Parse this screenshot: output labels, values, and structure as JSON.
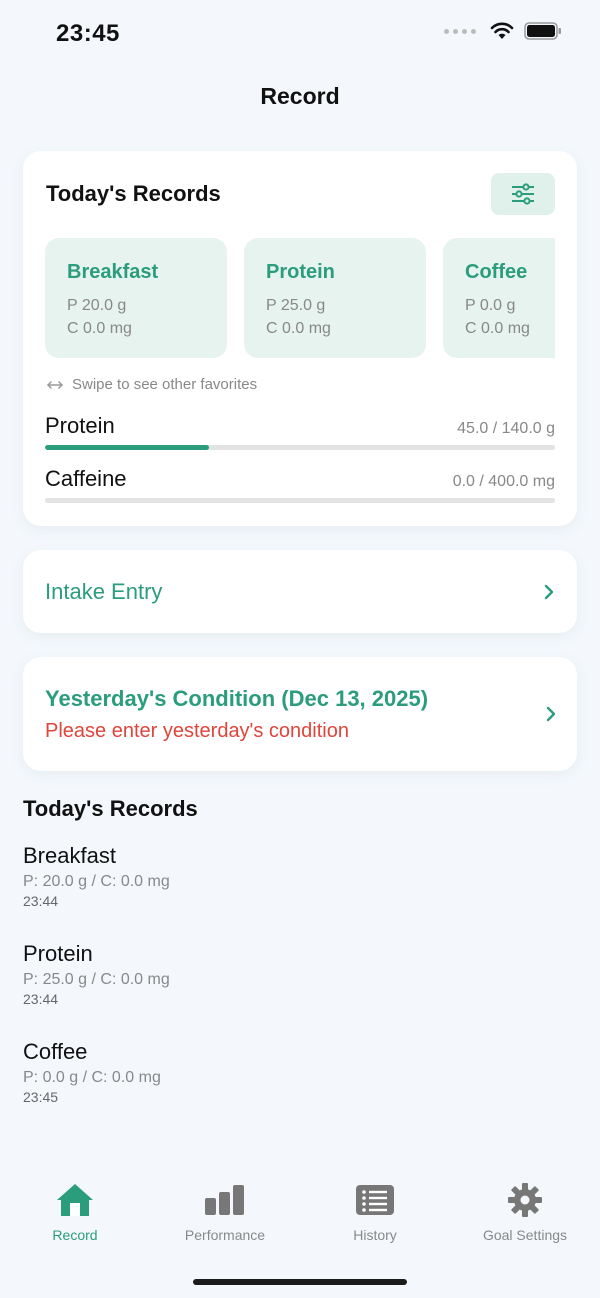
{
  "status_bar": {
    "time": "23:45"
  },
  "page": {
    "title": "Record"
  },
  "today_card": {
    "title": "Today's Records",
    "favorites": [
      {
        "name": "Breakfast",
        "protein": "P 20.0 g",
        "caffeine": "C 0.0 mg"
      },
      {
        "name": "Protein",
        "protein": "P 25.0 g",
        "caffeine": "C 0.0 mg"
      },
      {
        "name": "Coffee",
        "protein": "P 0.0 g",
        "caffeine": "C 0.0 mg"
      }
    ],
    "swipe_hint": "Swipe to see other favorites",
    "progress": [
      {
        "name": "Protein",
        "value": "45.0 / 140.0 g",
        "fraction": 0.321
      },
      {
        "name": "Caffeine",
        "value": "0.0 / 400.0 mg",
        "fraction": 0.0
      }
    ]
  },
  "intake_entry": {
    "label": "Intake Entry"
  },
  "condition": {
    "title": "Yesterday's Condition (Dec 13, 2025)",
    "subtitle": "Please enter yesterday's condition"
  },
  "records": {
    "title": "Today's Records",
    "items": [
      {
        "name": "Breakfast",
        "detail": "P: 20.0 g / C: 0.0 mg",
        "time": "23:44"
      },
      {
        "name": "Protein",
        "detail": "P: 25.0 g / C: 0.0 mg",
        "time": "23:44"
      },
      {
        "name": "Coffee",
        "detail": "P: 0.0 g / C: 0.0 mg",
        "time": "23:45"
      }
    ]
  },
  "tabs": [
    {
      "label": "Record",
      "icon": "home-icon",
      "active": true
    },
    {
      "label": "Performance",
      "icon": "bar-chart-icon",
      "active": false
    },
    {
      "label": "History",
      "icon": "list-icon",
      "active": false
    },
    {
      "label": "Goal Settings",
      "icon": "gear-icon",
      "active": false
    }
  ],
  "colors": {
    "accent": "#2b9d7c",
    "warning": "#e0453a",
    "background": "#f4f8fd"
  }
}
